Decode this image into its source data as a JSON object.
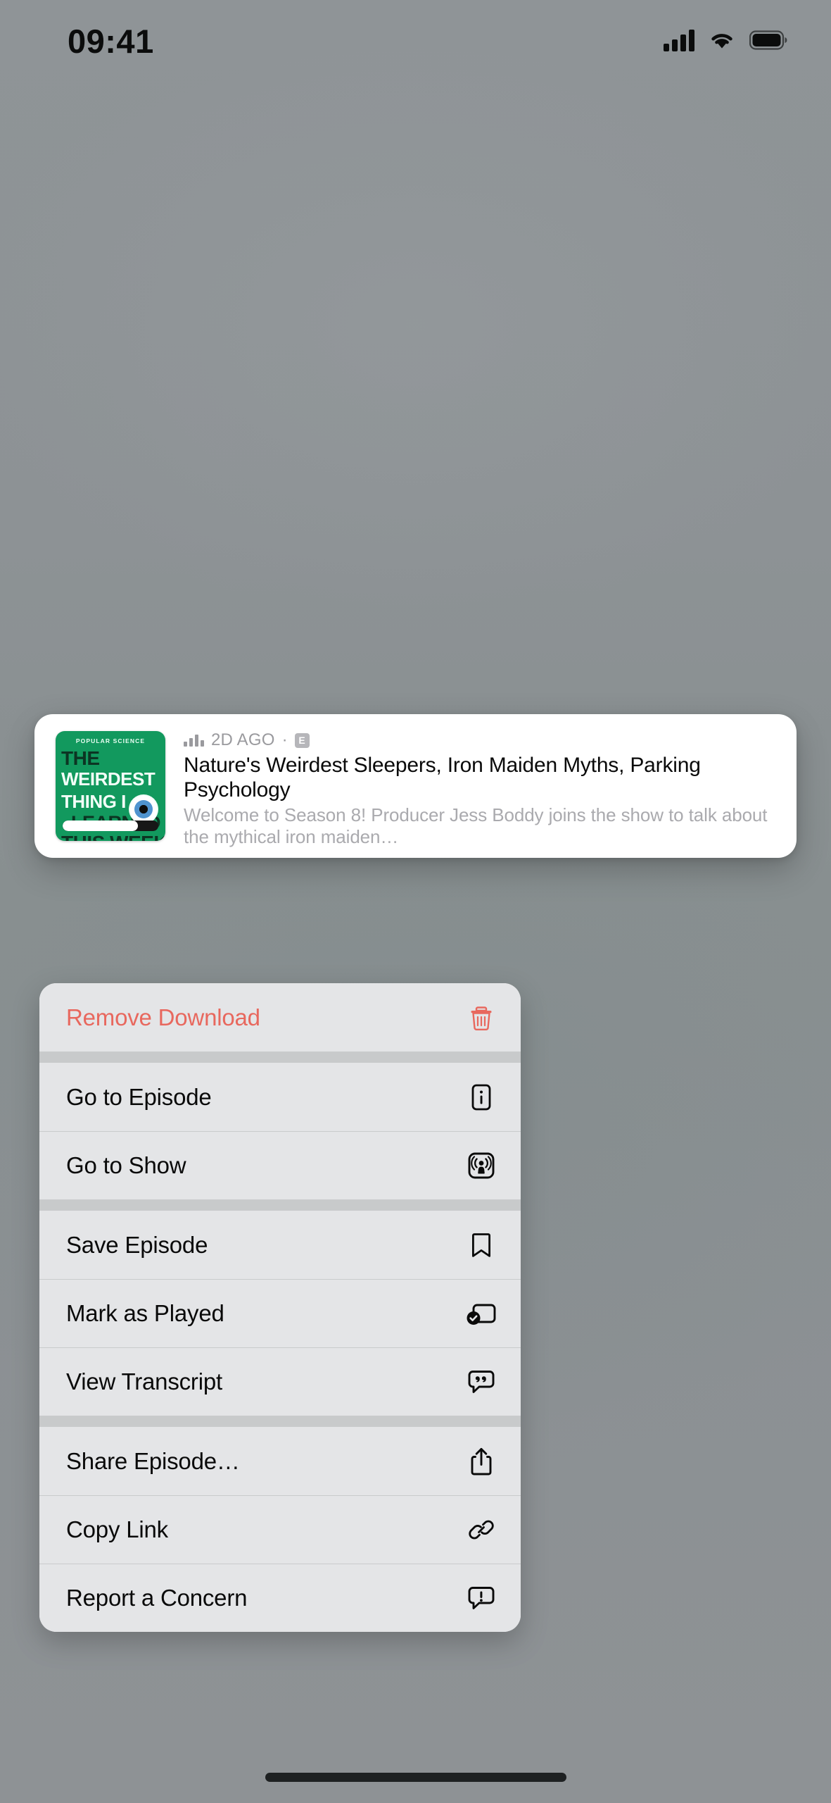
{
  "status_bar": {
    "time": "09:41",
    "icons": [
      "cellular-signal-icon",
      "wifi-icon",
      "battery-icon"
    ],
    "battery_full": true
  },
  "episode_card": {
    "artwork": {
      "name": "podcast-artwork",
      "kicker": "POPULAR SCIENCE",
      "lines": [
        "THE",
        "WEIRDEST",
        "THING I",
        "LEARNED",
        "THIS WEEK"
      ],
      "background_color": "#12995e",
      "accent_color": "#0c3523",
      "eye_icon": "eyeball-icon",
      "progress_percent": 79
    },
    "meta": {
      "waveform_icon": "audio-waveform-icon",
      "date": "2D AGO",
      "separator": "·",
      "explicit_badge": "E"
    },
    "title": "Nature's Weirdest Sleepers, Iron Maiden Myths, Parking Psychology",
    "description": "Welcome to Season 8! Producer Jess Boddy joins the show to talk about the mythical iron maiden…"
  },
  "context_menu": {
    "destructive_color": "#e8685e",
    "groups": [
      {
        "items": [
          {
            "label": "Remove Download",
            "icon": "trash-icon",
            "destructive": true
          }
        ]
      },
      {
        "items": [
          {
            "label": "Go to Episode",
            "icon": "info-square-icon",
            "destructive": false
          },
          {
            "label": "Go to Show",
            "icon": "podcast-square-icon",
            "destructive": false
          }
        ]
      },
      {
        "items": [
          {
            "label": "Save Episode",
            "icon": "bookmark-icon",
            "destructive": false
          },
          {
            "label": "Mark as Played",
            "icon": "mark-played-icon",
            "destructive": false
          },
          {
            "label": "View Transcript",
            "icon": "quote-bubble-icon",
            "destructive": false
          }
        ]
      },
      {
        "items": [
          {
            "label": "Share Episode…",
            "icon": "share-icon",
            "destructive": false
          },
          {
            "label": "Copy Link",
            "icon": "link-icon",
            "destructive": false
          },
          {
            "label": "Report a Concern",
            "icon": "exclamation-bubble-icon",
            "destructive": false
          }
        ]
      }
    ]
  },
  "home_indicator": {
    "name": "home-indicator"
  }
}
